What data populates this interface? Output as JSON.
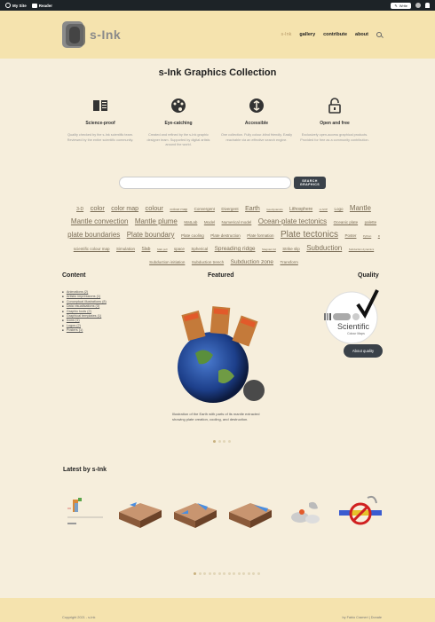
{
  "adminbar": {
    "site": "My Site",
    "reader": "Reader",
    "write": "Write"
  },
  "header": {
    "logo_text": "s-Ink",
    "nav": [
      "s-Ink",
      "gallery",
      "contribute",
      "about"
    ]
  },
  "main": {
    "title": "s-Ink Graphics Collection",
    "features": [
      {
        "icon": "book-icon",
        "title": "Science-proof",
        "text": "Quality checked by the s-Ink scientific team. Reviewed by the entire scientific community."
      },
      {
        "icon": "palette-icon",
        "title": "Eye-catching",
        "text": "Created and refined by the s-Ink graphic designer team. Supported by digital artists around the world."
      },
      {
        "icon": "accessible-icon",
        "title": "Accessible",
        "text": "One collection. Fully colour-blind friendly. Easily reachable via an effective search engine."
      },
      {
        "icon": "unlock-icon",
        "title": "Open and free",
        "text": "Exclusively open-access graphical products. Provided for free as a community contribution."
      }
    ],
    "search": {
      "placeholder": "",
      "button": "SEARCH GRAPHICS"
    },
    "tags": [
      {
        "t": "3-D",
        "s": 5
      },
      {
        "t": "color",
        "s": 7.5
      },
      {
        "t": "color map",
        "s": 7
      },
      {
        "t": "colour",
        "s": 7.5
      },
      {
        "t": "colour map",
        "s": 4
      },
      {
        "t": "Convergent",
        "s": 4.5
      },
      {
        "t": "Divergent",
        "s": 4.5
      },
      {
        "t": "Earth",
        "s": 7
      },
      {
        "t": "Geodynamics",
        "s": 3
      },
      {
        "t": "Lithosphere",
        "s": 5
      },
      {
        "t": "LLSVP",
        "s": 3
      },
      {
        "t": "Logo",
        "s": 4.5
      },
      {
        "t": "Mantle",
        "s": 8
      },
      {
        "t": "Mantle convection",
        "s": 8
      },
      {
        "t": "Mantle plume",
        "s": 8
      },
      {
        "t": "MatLab",
        "s": 4.5
      },
      {
        "t": "Model",
        "s": 4.5
      },
      {
        "t": "Numerical model",
        "s": 4.5
      },
      {
        "t": "Ocean-plate tectonics",
        "s": 8
      },
      {
        "t": "Oceanic plate",
        "s": 4.5
      },
      {
        "t": "palette",
        "s": 4.5
      },
      {
        "t": "plate boundaries",
        "s": 8
      },
      {
        "t": "Plate boundary",
        "s": 8
      },
      {
        "t": "Plate cooling",
        "s": 4.5
      },
      {
        "t": "Plate destruction",
        "s": 4.5
      },
      {
        "t": "Plate formation",
        "s": 4.5
      },
      {
        "t": "Plate tectonics",
        "s": 10
      },
      {
        "t": "Poster",
        "s": 4.5
      },
      {
        "t": "Python",
        "s": 3
      },
      {
        "t": "R",
        "s": 3
      },
      {
        "t": "scientific colour map",
        "s": 4.5
      },
      {
        "t": "Simulation",
        "s": 4.5
      },
      {
        "t": "Slab",
        "s": 5
      },
      {
        "t": "Slab pull",
        "s": 3
      },
      {
        "t": "space",
        "s": 4.5
      },
      {
        "t": "Spherical",
        "s": 4.5
      },
      {
        "t": "Spreading ridge",
        "s": 6.5
      },
      {
        "t": "Stagnant lid",
        "s": 3
      },
      {
        "t": "Strike slip",
        "s": 4.5
      },
      {
        "t": "Subduction",
        "s": 8
      },
      {
        "t": "Subduction dynamics",
        "s": 3
      },
      {
        "t": "Subduction initiation",
        "s": 4.5
      },
      {
        "t": "Subduction trench",
        "s": 4.5
      },
      {
        "t": "Subduction zone",
        "s": 6.5
      },
      {
        "t": "Transform",
        "s": 4.5
      }
    ],
    "content": {
      "heading": "Content",
      "items": [
        "Animations (2)",
        "Artistic impressions (1)",
        "Conceptual illustrations (8)",
        "Data visualisations (3)",
        "Graphic tools (2)",
        "Graphical templates (1)",
        "Icons (1)",
        "Logos (2)",
        "Posters (1)"
      ]
    },
    "featured": {
      "heading": "Featured",
      "caption": "Illustration of the Earth with parts of its mantle extracted showing plate creation, cooling, and destruction."
    },
    "quality": {
      "heading": "Quality",
      "badge_title": "Scientific",
      "badge_sub": "Colour Maps",
      "button": "About quality"
    },
    "latest": {
      "heading": "Latest by s-Ink"
    }
  },
  "footer": {
    "copyright": "Copyright 2021 - s-Ink",
    "credit": "by Fabio Crameri | Donate"
  },
  "colors": {
    "header_bg": "#f5e3ae",
    "page_bg": "#f6eedc",
    "dark_button": "#3a4149"
  }
}
